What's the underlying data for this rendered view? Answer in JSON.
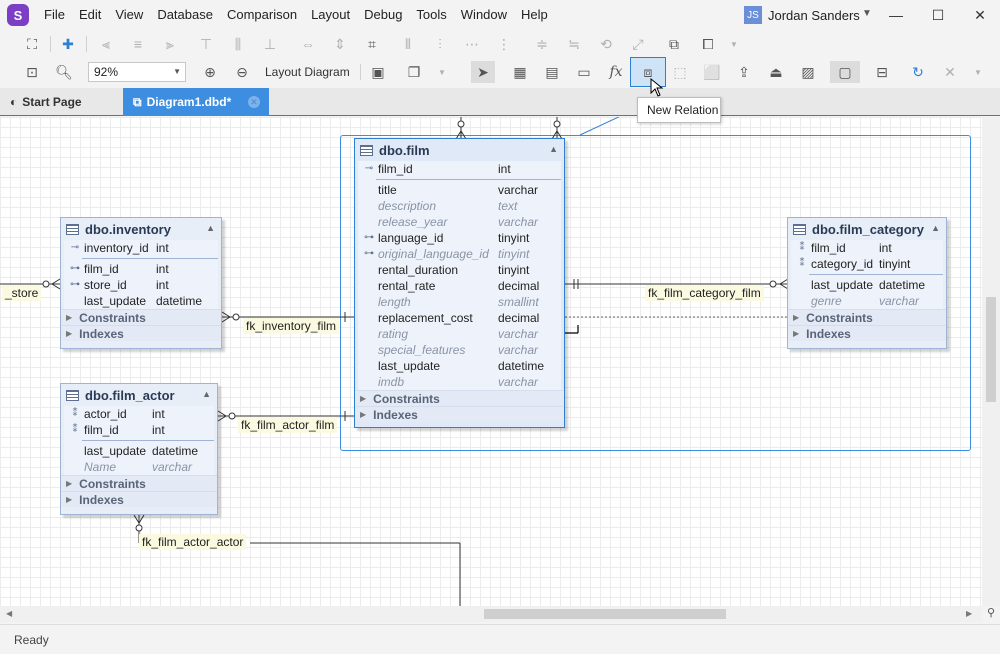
{
  "menubar": {
    "logo": "S",
    "items": [
      "File",
      "Edit",
      "View",
      "Database",
      "Comparison",
      "Layout",
      "Debug",
      "Tools",
      "Window",
      "Help"
    ],
    "user_initials": "JS",
    "user_name": "Jordan Sanders",
    "minimize": "—",
    "maximize": "☐",
    "close": "✕"
  },
  "toolbar2": {
    "zoom": "92%",
    "layout_label": "Layout Diagram",
    "fx": "fx"
  },
  "tabs": {
    "start": "Start Page",
    "diagram": "Diagram1.dbd*"
  },
  "tooltip": "New Relation",
  "status": "Ready",
  "entities": {
    "film": {
      "title": "dbo.film",
      "columns": [
        {
          "name": "film_id",
          "type": "int",
          "key": "pk",
          "italic": false
        },
        {
          "name": "title",
          "type": "varchar",
          "key": "",
          "italic": false
        },
        {
          "name": "description",
          "type": "text",
          "key": "",
          "italic": true
        },
        {
          "name": "release_year",
          "type": "varchar",
          "key": "",
          "italic": true
        },
        {
          "name": "language_id",
          "type": "tinyint",
          "key": "fk",
          "italic": false
        },
        {
          "name": "original_language_id",
          "type": "tinyint",
          "key": "fk",
          "italic": true
        },
        {
          "name": "rental_duration",
          "type": "tinyint",
          "key": "",
          "italic": false
        },
        {
          "name": "rental_rate",
          "type": "decimal",
          "key": "",
          "italic": false
        },
        {
          "name": "length",
          "type": "smallint",
          "key": "",
          "italic": true
        },
        {
          "name": "replacement_cost",
          "type": "decimal",
          "key": "",
          "italic": false
        },
        {
          "name": "rating",
          "type": "varchar",
          "key": "",
          "italic": true
        },
        {
          "name": "special_features",
          "type": "varchar",
          "key": "",
          "italic": true
        },
        {
          "name": "last_update",
          "type": "datetime",
          "key": "",
          "italic": false
        },
        {
          "name": "imdb",
          "type": "varchar",
          "key": "",
          "italic": true
        }
      ],
      "sections": [
        "Constraints",
        "Indexes"
      ]
    },
    "inventory": {
      "title": "dbo.inventory",
      "columns": [
        {
          "name": "inventory_id",
          "type": "int",
          "key": "pk",
          "italic": false
        },
        {
          "name": "film_id",
          "type": "int",
          "key": "fk",
          "italic": false
        },
        {
          "name": "store_id",
          "type": "int",
          "key": "fk",
          "italic": false
        },
        {
          "name": "last_update",
          "type": "datetime",
          "key": "",
          "italic": false
        }
      ],
      "sections": [
        "Constraints",
        "Indexes"
      ]
    },
    "film_actor": {
      "title": "dbo.film_actor",
      "columns": [
        {
          "name": "actor_id",
          "type": "int",
          "key": "pkfk",
          "italic": false
        },
        {
          "name": "film_id",
          "type": "int",
          "key": "pkfk",
          "italic": false
        },
        {
          "name": "last_update",
          "type": "datetime",
          "key": "",
          "italic": false
        },
        {
          "name": "Name",
          "type": "varchar",
          "key": "",
          "italic": true
        }
      ],
      "sections": [
        "Constraints",
        "Indexes"
      ]
    },
    "film_category": {
      "title": "dbo.film_category",
      "columns": [
        {
          "name": "film_id",
          "type": "int",
          "key": "pkfk",
          "italic": false
        },
        {
          "name": "category_id",
          "type": "tinyint",
          "key": "pkfk",
          "italic": false
        },
        {
          "name": "last_update",
          "type": "datetime",
          "key": "",
          "italic": false
        },
        {
          "name": "genre",
          "type": "varchar",
          "key": "",
          "italic": true
        }
      ],
      "sections": [
        "Constraints",
        "Indexes"
      ]
    }
  },
  "relations": {
    "store": "_store",
    "inventory_film": "fk_inventory_film",
    "film_actor_film": "fk_film_actor_film",
    "film_category_film": "fk_film_category_film",
    "film_actor_actor": "fk_film_actor_actor"
  }
}
